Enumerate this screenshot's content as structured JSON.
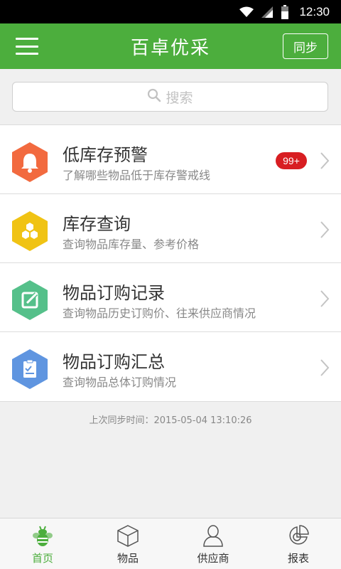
{
  "status_bar": {
    "time": "12:30",
    "icons": [
      "wifi-icon",
      "signal-icon",
      "battery-icon"
    ]
  },
  "header": {
    "title": "百卓优采",
    "sync_label": "同步",
    "menu_icon": "hamburger-menu-icon"
  },
  "search": {
    "placeholder": "搜索",
    "icon": "search-icon"
  },
  "list": {
    "items": [
      {
        "title": "低库存预警",
        "subtitle": "了解哪些物品低于库存警戒线",
        "badge": "99+",
        "icon": "bell-icon",
        "color": "#f26a3f"
      },
      {
        "title": "库存查询",
        "subtitle": "查询物品库存量、参考价格",
        "icon": "hexagons-icon",
        "color": "#f0c314"
      },
      {
        "title": "物品订购记录",
        "subtitle": "查询物品历史订购价、往来供应商情况",
        "icon": "edit-icon",
        "color": "#55c08a"
      },
      {
        "title": "物品订购汇总",
        "subtitle": "查询物品总体订购情况",
        "icon": "clipboard-icon",
        "color": "#5f95e0"
      }
    ]
  },
  "sync_time": "上次同步时间：2015-05-04 13:10:26",
  "bottom_nav": {
    "tabs": [
      {
        "label": "首页",
        "icon": "bee-home-icon",
        "active": true
      },
      {
        "label": "物品",
        "icon": "box-icon",
        "active": false
      },
      {
        "label": "供应商",
        "icon": "person-icon",
        "active": false
      },
      {
        "label": "报表",
        "icon": "chart-icon",
        "active": false
      }
    ]
  },
  "colors": {
    "brand_green": "#4cae3d",
    "badge_red": "#d81e22"
  }
}
